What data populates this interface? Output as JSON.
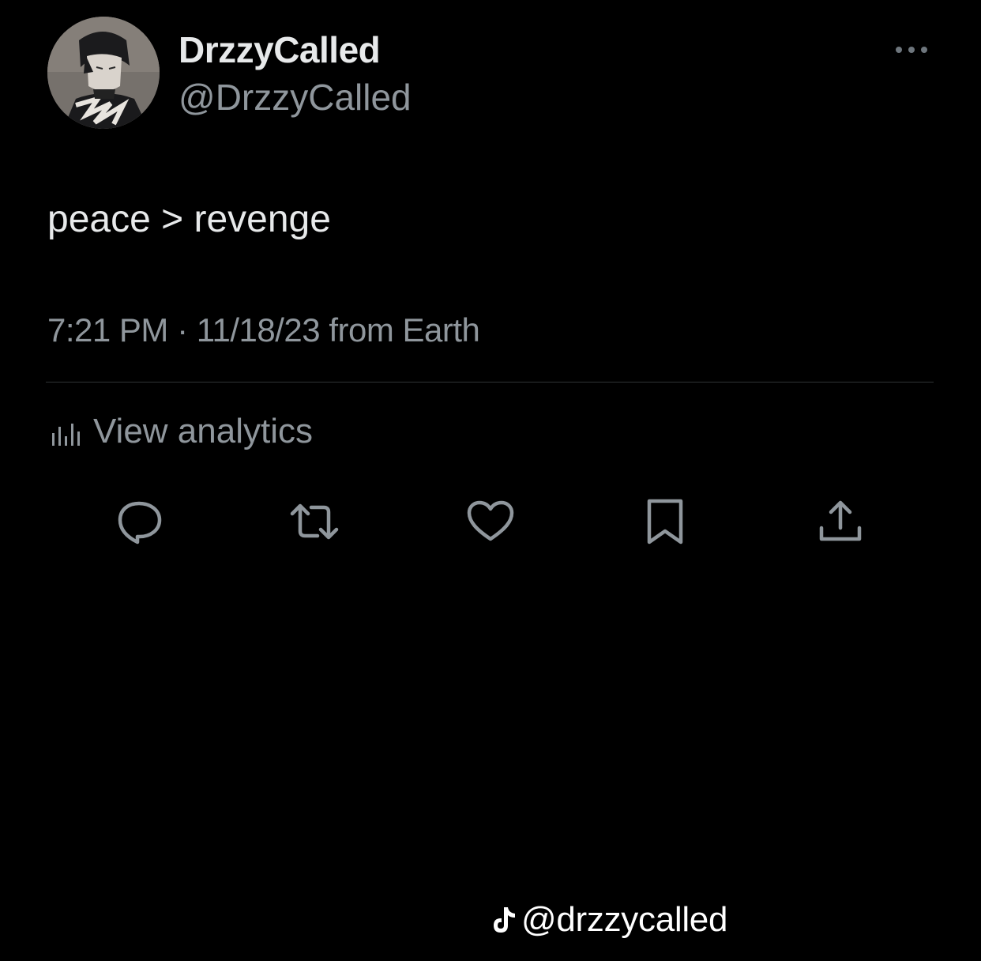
{
  "user": {
    "display_name": "DrzzyCalled",
    "handle": "@DrzzyCalled"
  },
  "tweet": {
    "text": "peace > revenge",
    "time": "7:21 PM",
    "separator": "·",
    "date": "11/18/23",
    "source": "from Earth"
  },
  "analytics": {
    "label": "View analytics"
  },
  "actions": [
    "reply-icon",
    "retweet-icon",
    "like-icon",
    "bookmark-icon",
    "share-icon"
  ],
  "watermark": {
    "text": "@drzzycalled"
  },
  "colors": {
    "background": "#000000",
    "primary_text": "#e7e9ea",
    "secondary_text": "#8f969c",
    "divider": "#2f3336",
    "icon": "#8f969c"
  }
}
